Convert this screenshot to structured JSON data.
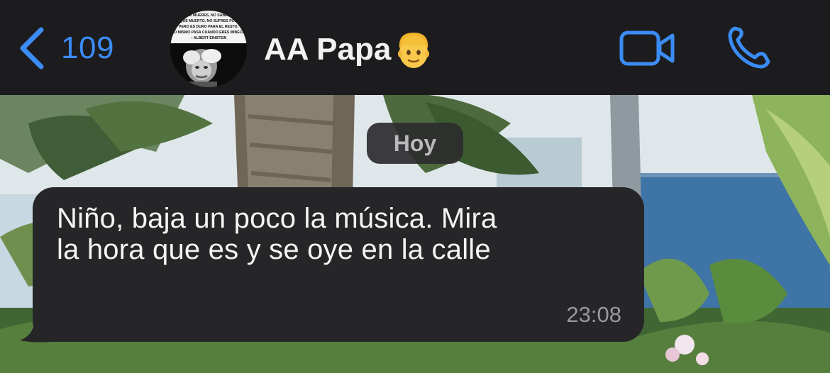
{
  "header": {
    "back_count": "109",
    "contact_name": "AA Papa",
    "avatar": {
      "quote_lines": [
        "TE MUERES, NO SABES",
        "QUE MUERTO. NO SUFRES POR",
        "PERO ES DURO PARA EL RESTO.",
        "LO MISMO PASA CUANDO ERES IMBÉCIL",
        "– ALBERT EINSTEIN"
      ]
    }
  },
  "chat": {
    "date_divider": "Hoy",
    "messages": [
      {
        "text": "Niño, baja un poco la música. Mira\nla hora que es y se oye en la calle",
        "time": "23:08",
        "direction": "incoming"
      }
    ]
  },
  "colors": {
    "accent": "#3c8cf5",
    "header_bg": "#1c1c1e",
    "bubble_bg": "#262628",
    "time_text": "#9a9a9e"
  },
  "icons": {
    "back": "chevron-left-icon",
    "video": "video-camera-icon",
    "call": "phone-icon",
    "name_emoji": "man-emoji-icon"
  }
}
